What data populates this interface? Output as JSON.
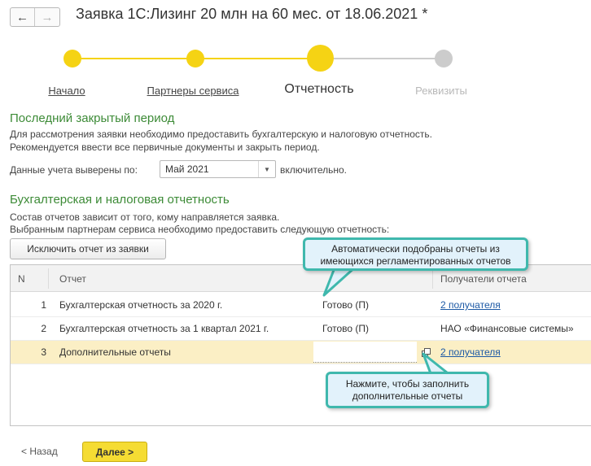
{
  "header": {
    "back_icon": "arrow-left-icon",
    "forward_icon": "arrow-right-icon",
    "title": "Заявка 1С:Лизинг 20 млн на 60 мес. от 18.06.2021 *"
  },
  "stepper": {
    "steps": [
      {
        "label": "Начало",
        "state": "done"
      },
      {
        "label": "Партнеры сервиса",
        "state": "done"
      },
      {
        "label": "Отчетность",
        "state": "current"
      },
      {
        "label": "Реквизиты",
        "state": "disabled"
      }
    ],
    "colors": {
      "active": "#f5d314",
      "inactive": "#cccccc"
    }
  },
  "period_section": {
    "title": "Последний закрытый период",
    "line1": "Для рассмотрения заявки необходимо предоставить бухгалтерскую и налоговую отчетность.",
    "line2": "Рекомендуется ввести все первичные документы и закрыть период.",
    "period_label": "Данные учета выверены по:",
    "period_value": "Май 2021",
    "period_suffix": "включительно."
  },
  "reports_section": {
    "title": "Бухгалтерская и налоговая отчетность",
    "line1": "Состав отчетов зависит от того, кому направляется заявка.",
    "line2": "Выбранным партнерам сервиса необходимо предоставить следующую отчетность:",
    "exclude_button": "Исключить отчет из заявки"
  },
  "table": {
    "columns": {
      "n": "N",
      "report": "Отчет",
      "recipients": "Получатели отчета"
    },
    "rows": [
      {
        "n": "1",
        "report": "Бухгалтерская отчетность за 2020 г.",
        "status": "Готово (П)",
        "recipients": "2 получателя"
      },
      {
        "n": "2",
        "report": "Бухгалтерская отчетность за 1 квартал 2021 г.",
        "status": "Готово (П)",
        "recipients": "НАО «Финансовые системы»"
      },
      {
        "n": "3",
        "report": "Дополнительные отчеты",
        "status": "",
        "recipients": "2 получателя"
      }
    ]
  },
  "callouts": {
    "top": "Автоматически подобраны отчеты из имеющихся регламентированных отчетов",
    "bottom": "Нажмите, чтобы заполнить дополнительные отчеты"
  },
  "footer": {
    "back": "< Назад",
    "next": "Далее >"
  }
}
